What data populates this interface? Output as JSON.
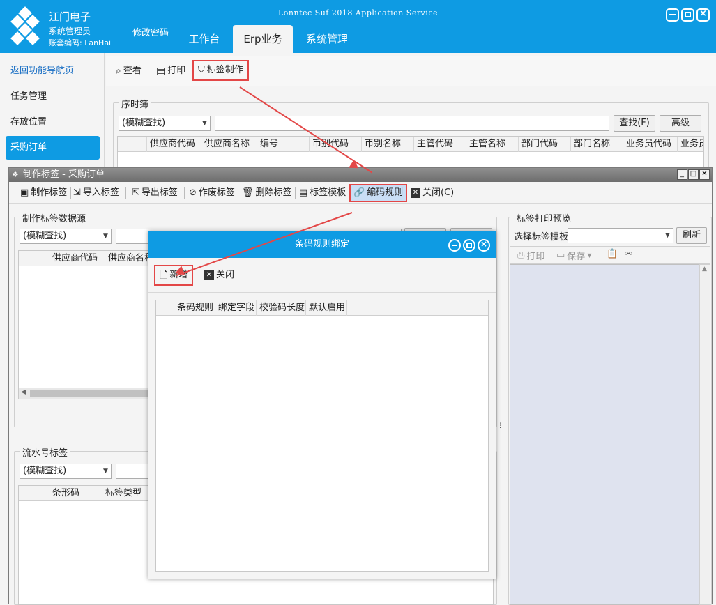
{
  "header": {
    "company": "江门电子",
    "user_role": "系统管理员",
    "account": "账套编码: LanHai",
    "change_password": "修改密码",
    "app_title": "Lonntec Suf 2018 Application Service",
    "tabs": [
      {
        "label": "工作台",
        "active": false
      },
      {
        "label": "Erp业务",
        "active": true
      },
      {
        "label": "系统管理",
        "active": false
      }
    ]
  },
  "sidebar": {
    "items": [
      {
        "label": "返回功能导航页"
      },
      {
        "label": "任务管理"
      },
      {
        "label": "存放位置"
      },
      {
        "label": "采购订单"
      }
    ]
  },
  "main": {
    "toolbar": {
      "view": "查看",
      "print": "打印",
      "make_label": "标签制作"
    },
    "group_title": "序时簿",
    "search_mode": "(模糊查找)",
    "search_button": "查找(F)",
    "advanced_button": "高级",
    "columns": [
      "供应商代码",
      "供应商名称",
      "编号",
      "币别代码",
      "币别名称",
      "主管代码",
      "主管名称",
      "部门代码",
      "部门名称",
      "业务员代码",
      "业务员"
    ]
  },
  "make_label_dialog": {
    "title": "制作标签 - 采购订单",
    "toolbar": {
      "make": "制作标签",
      "import": "导入标签",
      "export": "导出标签",
      "void": "作废标签",
      "delete": "删除标签",
      "template": "标签模板",
      "encoding_rule": "编码规则",
      "close": "关闭(C)"
    },
    "source_group": {
      "title": "制作标签数据源",
      "search_mode": "(模糊查找)",
      "columns": [
        "供应商代码",
        "供应商名称"
      ]
    },
    "serial_group": {
      "title": "流水号标签",
      "search_mode": "(模糊查找)",
      "columns": [
        "条形码",
        "标签类型"
      ]
    },
    "preview": {
      "title": "标签打印预览",
      "template_label": "选择标签模板",
      "refresh_button": "刷新",
      "print": "打印",
      "save": "保存"
    }
  },
  "barcode_dialog": {
    "title": "条码规则绑定",
    "toolbar": {
      "add": "新增",
      "close": "关闭"
    },
    "columns": [
      "条码规则",
      "绑定字段",
      "校验码长度",
      "默认启用"
    ]
  },
  "colors": {
    "accent": "#0e9be3",
    "highlight_box": "#e34747",
    "dialog_title_gray": "#7a7a7a",
    "preview_bg": "#dfe3ef"
  }
}
